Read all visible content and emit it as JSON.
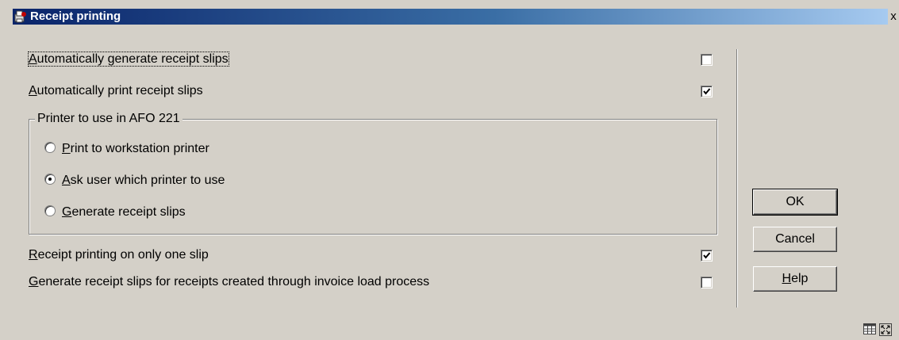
{
  "window": {
    "title": "Receipt printing",
    "close_glyph": "x"
  },
  "options": {
    "auto_generate": {
      "key": "A",
      "rest": "utomatically generate receipt slips",
      "checked": false
    },
    "auto_print": {
      "key": "A",
      "rest": "utomatically print receipt slips",
      "checked": true
    },
    "one_slip": {
      "key": "R",
      "rest": "eceipt printing on only one slip",
      "checked": true
    },
    "invoice_load": {
      "key": "G",
      "rest": "enerate receipt slips for receipts created through invoice load process",
      "checked": false
    }
  },
  "printer_group": {
    "label": "Printer to use in AFO 221",
    "radios": [
      {
        "key": "P",
        "rest": "rint to workstation printer",
        "selected": false
      },
      {
        "key": "A",
        "rest": "sk user which printer to use",
        "selected": true
      },
      {
        "key": "G",
        "rest": "enerate receipt slips",
        "selected": false
      }
    ]
  },
  "buttons": {
    "ok": "OK",
    "cancel": "Cancel",
    "help_key": "H",
    "help_rest": "elp"
  },
  "icons": {
    "window_icon": "receipt-printer-icon",
    "status_1": "grid-icon",
    "status_2": "resize-icon"
  },
  "colors": {
    "title_start": "#0a246a",
    "title_end": "#a6caf0",
    "dialog_bg": "#d4d0c8"
  }
}
